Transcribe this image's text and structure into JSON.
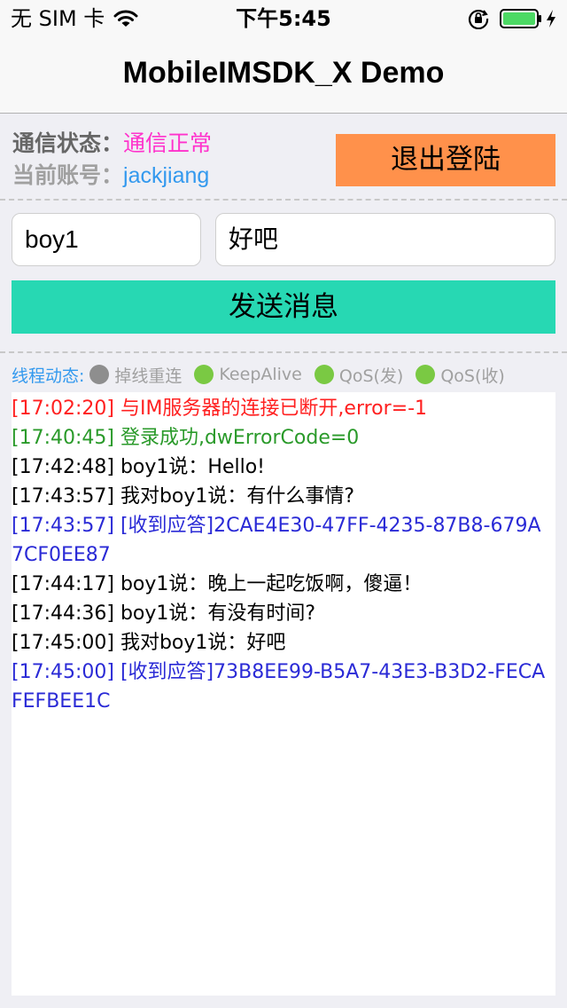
{
  "status_bar": {
    "carrier": "无 SIM 卡",
    "time": "下午5:45"
  },
  "nav": {
    "title": "MobileIMSDK_X Demo"
  },
  "status": {
    "comm_label": "通信状态：",
    "comm_value": "通信正常",
    "account_label": "当前账号：",
    "account_value": "jackjiang",
    "logout_label": "退出登陆"
  },
  "input": {
    "to_user": "boy1",
    "message": "好吧",
    "send_label": "发送消息"
  },
  "threads": {
    "title": "线程动态:",
    "items": [
      {
        "label": "掉线重连",
        "color": "#8e8e8e"
      },
      {
        "label": "KeepAlive",
        "color": "#7ac943"
      },
      {
        "label": "QoS(发)",
        "color": "#7ac943"
      },
      {
        "label": "QoS(收)",
        "color": "#7ac943"
      }
    ]
  },
  "colors": {
    "logout": "#ff914b",
    "send": "#27d8b3",
    "red": "#ff2020",
    "green": "#2a9a2a",
    "blue": "#2a2ad6",
    "black": "#000000"
  },
  "log": [
    {
      "text": "[17:02:20] 与IM服务器的连接已断开,error=-1",
      "color": "#ff2020"
    },
    {
      "text": "[17:40:45] 登录成功,dwErrorCode=0",
      "color": "#2a9a2a"
    },
    {
      "text": "[17:42:48] boy1说：Hello!",
      "color": "#000000"
    },
    {
      "text": "[17:43:57] 我对boy1说：有什么事情?",
      "color": "#000000"
    },
    {
      "text": "[17:43:57] [收到应答]2CAE4E30-47FF-4235-87B8-679A7CF0EE87",
      "color": "#2a2ad6"
    },
    {
      "text": "[17:44:17] boy1说：晚上一起吃饭啊，傻逼！",
      "color": "#000000"
    },
    {
      "text": "[17:44:36] boy1说：有没有时间?",
      "color": "#000000"
    },
    {
      "text": "[17:45:00] 我对boy1说：好吧",
      "color": "#000000"
    },
    {
      "text": "[17:45:00] [收到应答]73B8EE99-B5A7-43E3-B3D2-FECAFEFBEE1C",
      "color": "#2a2ad6"
    }
  ]
}
